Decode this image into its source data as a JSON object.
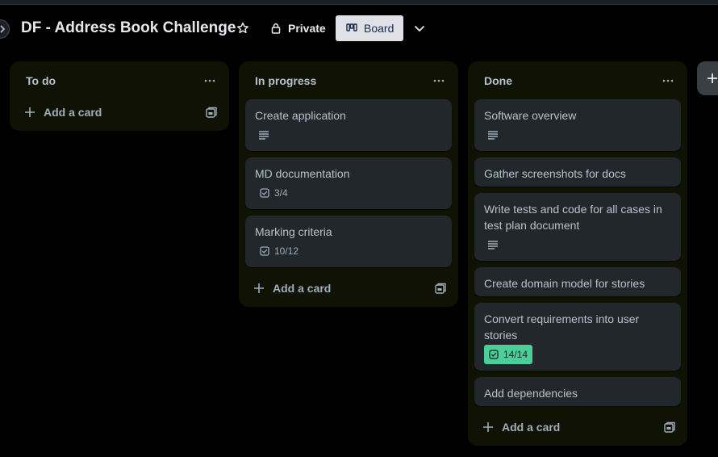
{
  "header": {
    "board_title": "DF - Address Book Challenge",
    "visibility_label": "Private",
    "view_label": "Board"
  },
  "icons": {
    "star": "star-icon",
    "lock": "lock-icon",
    "board": "board-view-icon",
    "chevron": "chevron-down-icon",
    "more": "ellipsis-icon",
    "plus": "plus-icon",
    "description": "description-icon",
    "checklist": "checklist-icon",
    "template": "card-template-icon"
  },
  "colors": {
    "background": "#000000",
    "list_bg": "#101204",
    "card_bg": "#22272b",
    "complete_badge": "#4bce97",
    "view_button_bg": "#dfe1e6"
  },
  "lists": [
    {
      "title": "To do",
      "add_card_label": "Add a card",
      "cards": []
    },
    {
      "title": "In progress",
      "add_card_label": "Add a card",
      "cards": [
        {
          "title": "Create application",
          "has_description": true
        },
        {
          "title": "MD documentation",
          "checklist": "3/4"
        },
        {
          "title": "Marking criteria",
          "checklist": "10/12"
        }
      ]
    },
    {
      "title": "Done",
      "add_card_label": "Add a card",
      "cards": [
        {
          "title": "Software overview",
          "has_description": true
        },
        {
          "title": "Gather screenshots for docs"
        },
        {
          "title": "Write tests and code for all cases in test plan document",
          "has_description": true
        },
        {
          "title": "Create domain model for stories"
        },
        {
          "title": "Convert requirements into user stories",
          "checklist": "14/14",
          "checklist_complete": true
        },
        {
          "title": "Add dependencies"
        }
      ]
    }
  ]
}
